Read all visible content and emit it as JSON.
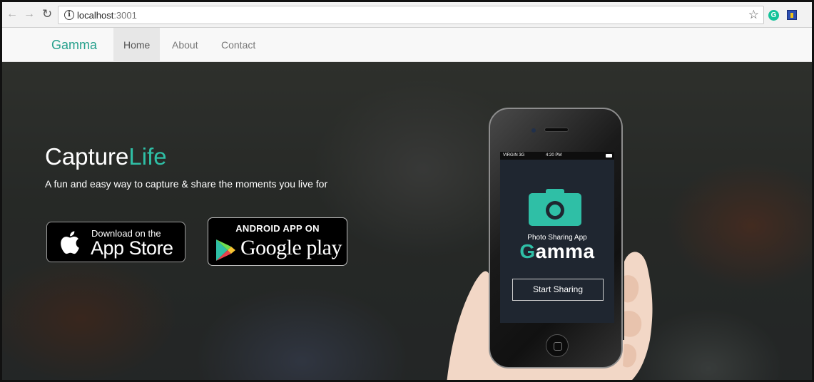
{
  "browser": {
    "url_host": "localhost",
    "url_port": ":3001",
    "back_icon": "arrow-left-icon",
    "forward_icon": "arrow-right-icon",
    "reload_icon": "reload-icon",
    "info_icon": "info-icon",
    "star_icon": "star-icon",
    "ext_grammarly_label": "G"
  },
  "navbar": {
    "brand": "Gamma",
    "links": [
      {
        "label": "Home",
        "active": true
      },
      {
        "label": "About",
        "active": false
      },
      {
        "label": "Contact",
        "active": false
      }
    ],
    "brand_color": "#26a08c"
  },
  "hero": {
    "title_main": "Capture",
    "title_accent": "Life",
    "subtitle": "A fun and easy way to capture & share the moments you live for",
    "accent_color": "#2fbfa6"
  },
  "badges": {
    "appstore_small": "Download on the",
    "appstore_big": "App Store",
    "gplay_small": "ANDROID APP ON",
    "gplay_big": "Google play"
  },
  "phone": {
    "carrier": "VIRGIN 3G",
    "time": "4:20 PM",
    "app_tagline": "Photo Sharing App",
    "app_name_initial": "G",
    "app_name_rest": "amma",
    "cta": "Start Sharing"
  }
}
